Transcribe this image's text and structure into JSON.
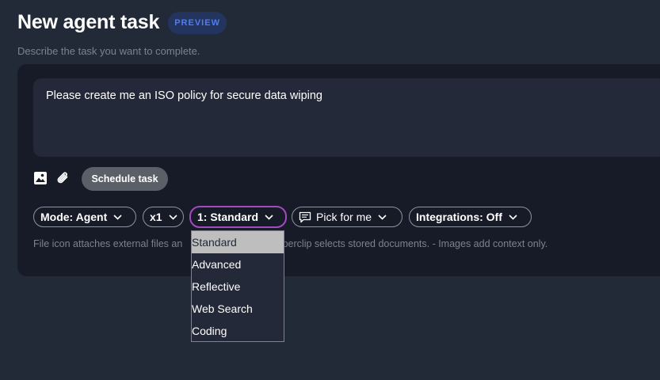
{
  "header": {
    "title": "New agent task",
    "badge": "PREVIEW",
    "subtitle": "Describe the task you want to complete."
  },
  "prompt": {
    "text": "Please create me an ISO policy for secure data wiping"
  },
  "actions": {
    "image_icon": "image-icon",
    "attach_icon": "paperclip-icon",
    "schedule_label": "Schedule task"
  },
  "options": {
    "mode_label": "Mode: Agent",
    "multiplier_label": "x1",
    "level_label": "1: Standard",
    "pick_label": "Pick for me",
    "integrations_label": "Integrations: Off"
  },
  "help": {
    "text_left": "File icon attaches external files an",
    "text_right": "ed). Paperclip selects stored documents. - Images add context only."
  },
  "dropdown": {
    "selected": "Standard",
    "items": [
      "Standard",
      "Advanced",
      "Reflective",
      "Web Search",
      "Coding"
    ]
  },
  "colors": {
    "background": "#222937",
    "panel": "#161b27",
    "accent_border": "#a44ac0",
    "badge_text": "#4f7df0",
    "badge_bg": "#23355f"
  }
}
